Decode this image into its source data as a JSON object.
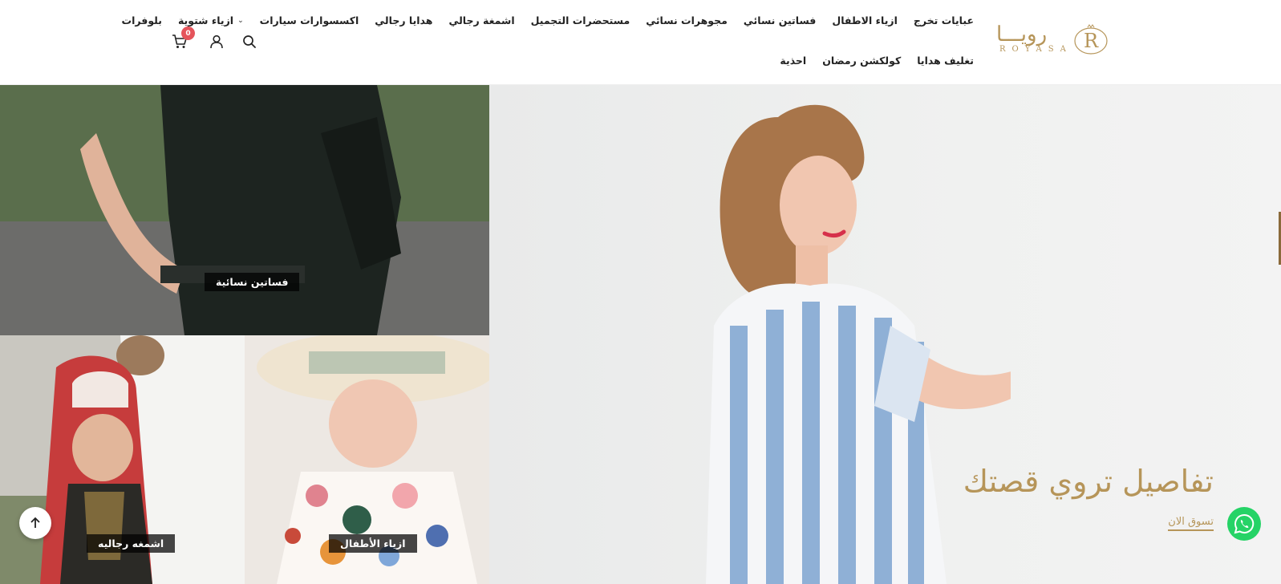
{
  "brand": {
    "name_ar": "رويـــا",
    "name_en": "ROYASA",
    "mark": "R",
    "color": "#b69559"
  },
  "nav": {
    "row1": [
      {
        "label": "عبايات تخرج",
        "id": "graduation-abayas"
      },
      {
        "label": "ازياء الاطفال",
        "id": "kids-fashion"
      },
      {
        "label": "فساتين نسائي",
        "id": "women-dresses"
      },
      {
        "label": "مجوهرات نسائي",
        "id": "women-jewelry"
      },
      {
        "label": "مستحضرات التجميل",
        "id": "cosmetics"
      },
      {
        "label": "اشمغة رجالي",
        "id": "men-shemaghs"
      },
      {
        "label": "هدايا رجالي",
        "id": "men-gifts"
      },
      {
        "label": "اكسسوارات سيارات",
        "id": "car-accessories"
      },
      {
        "label": "ازياء شتوية",
        "id": "winter-fashion",
        "dropdown_icon": "chevron-down-icon"
      },
      {
        "label": "بلوفرات",
        "id": "pullovers"
      }
    ],
    "row2": [
      {
        "label": "تغليف هدايا",
        "id": "gift-wrapping"
      },
      {
        "label": "كولكشن رمضان",
        "id": "ramadan-collection"
      },
      {
        "label": "احذية",
        "id": "shoes"
      }
    ]
  },
  "header_icons": {
    "search": "search-icon",
    "account": "user-icon",
    "cart": "cart-icon",
    "cart_count": "0",
    "badge_color": "#e5545b"
  },
  "hero": {
    "title": "تفاصيل تروي قصتك",
    "cta": "تسوق الان",
    "accent": "#b69559"
  },
  "tiles": {
    "top": {
      "label": "فساتين نسائية"
    },
    "kids": {
      "label": "ازياء الأطفال"
    },
    "men": {
      "label": "اشمغه رجاليه"
    }
  },
  "floating": {
    "whatsapp": "whatsapp-icon",
    "whatsapp_color": "#25d366",
    "scroll_top": "arrow-up-icon"
  }
}
